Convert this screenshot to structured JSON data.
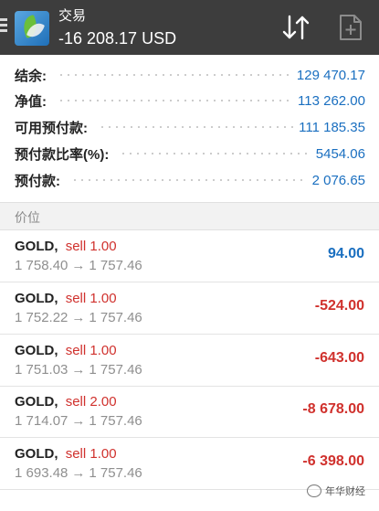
{
  "appbar": {
    "title": "交易",
    "balance_subtitle": "-16 208.17 USD",
    "sort_icon": "sort-arrows-icon",
    "new_order_icon": "new-order-icon"
  },
  "summary": [
    {
      "label": "结余:",
      "value": "129 470.17"
    },
    {
      "label": "净值:",
      "value": "113 262.00"
    },
    {
      "label": "可用预付款:",
      "value": "111 185.35"
    },
    {
      "label": "预付款比率(%):",
      "value": "5454.06"
    },
    {
      "label": "预付款:",
      "value": "2 076.65"
    }
  ],
  "section": {
    "label": "价位"
  },
  "positions": [
    {
      "symbol": "GOLD",
      "side": "sell 1.00",
      "open": "1 758.40",
      "current": "1 757.46",
      "profit": "94.00",
      "profit_color": "#1a6fc0"
    },
    {
      "symbol": "GOLD",
      "side": "sell 1.00",
      "open": "1 752.22",
      "current": "1 757.46",
      "profit": "-524.00",
      "profit_color": "#d0312d"
    },
    {
      "symbol": "GOLD",
      "side": "sell 1.00",
      "open": "1 751.03",
      "current": "1 757.46",
      "profit": "-643.00",
      "profit_color": "#d0312d"
    },
    {
      "symbol": "GOLD",
      "side": "sell 2.00",
      "open": "1 714.07",
      "current": "1 757.46",
      "profit": "-8 678.00",
      "profit_color": "#d0312d"
    },
    {
      "symbol": "GOLD",
      "side": "sell 1.00",
      "open": "1 693.48",
      "current": "1 757.46",
      "profit": "-6 398.00",
      "profit_color": "#d0312d"
    }
  ],
  "watermark": {
    "text": "年华财经"
  },
  "colors": {
    "appbar": "#3d3d3d",
    "positive": "#1a6fc0",
    "negative": "#d0312d",
    "muted": "#8f8f8f"
  }
}
